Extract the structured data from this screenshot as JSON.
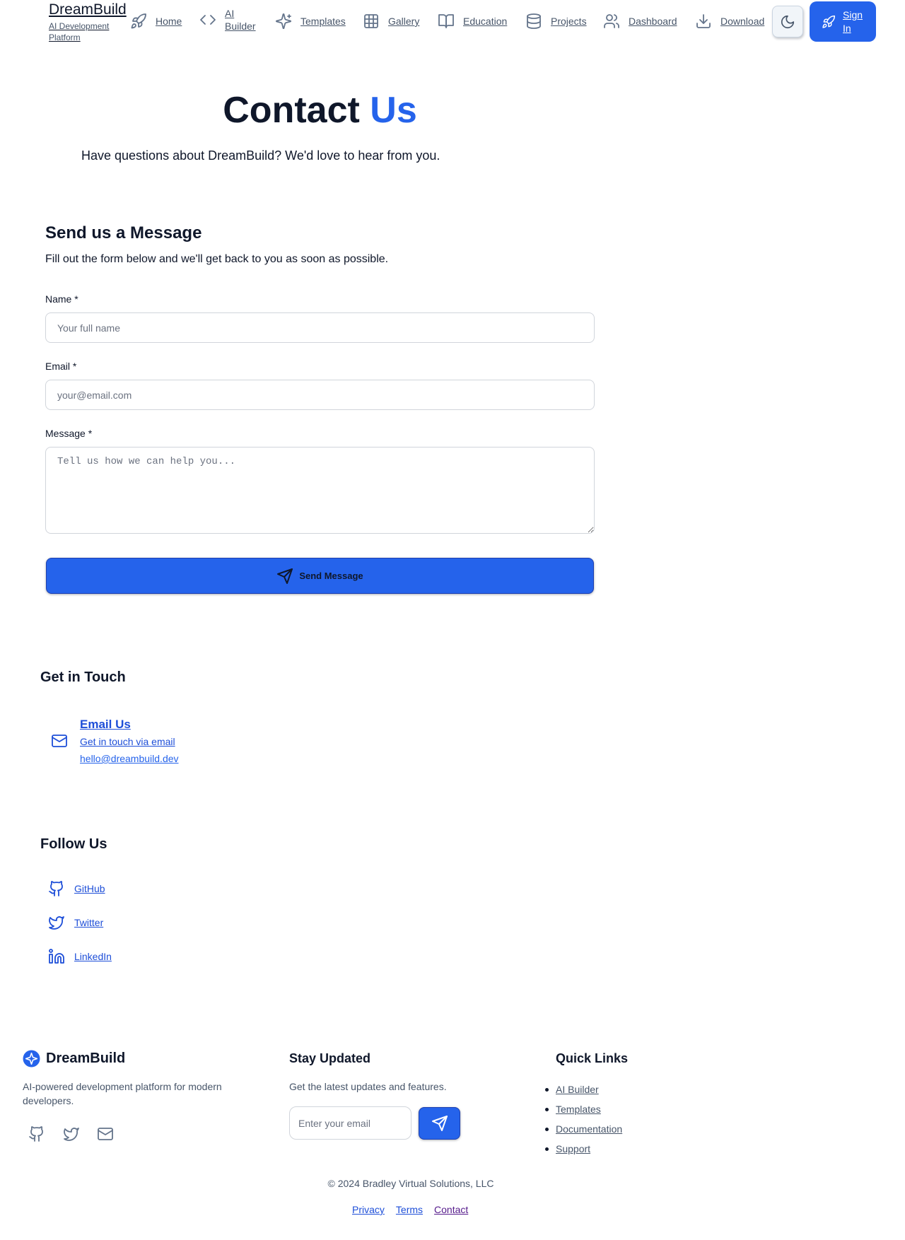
{
  "header": {
    "brand": "DreamBuild",
    "tagline": "AI Development Platform",
    "nav": [
      {
        "label": "Home",
        "icon": "rocket-icon"
      },
      {
        "label": "AI Builder",
        "icon": "code-icon"
      },
      {
        "label": "Templates",
        "icon": "sparkles-icon"
      },
      {
        "label": "Gallery",
        "icon": "grid-icon"
      },
      {
        "label": "Education",
        "icon": "book-open-icon"
      },
      {
        "label": "Projects",
        "icon": "database-icon"
      },
      {
        "label": "Dashboard",
        "icon": "users-icon"
      },
      {
        "label": "Download",
        "icon": "download-icon"
      }
    ],
    "theme_toggle_icon": "moon-icon",
    "signin": "Sign In"
  },
  "hero": {
    "title_main": "Contact",
    "title_accent": "Us",
    "subtitle": "Have questions about DreamBuild? We'd love to hear from you."
  },
  "form": {
    "title": "Send us a Message",
    "description": "Fill out the form below and we'll get back to you as soon as possible.",
    "name_label": "Name *",
    "name_placeholder": "Your full name",
    "email_label": "Email *",
    "email_placeholder": "your@email.com",
    "message_label": "Message *",
    "message_placeholder": "Tell us how we can help you...",
    "submit": "Send Message"
  },
  "contact": {
    "title": "Get in Touch",
    "email_title": "Email Us",
    "email_desc": "Get in touch via email",
    "email_address": "hello@dreambuild.dev"
  },
  "follow": {
    "title": "Follow Us",
    "items": [
      {
        "label": "GitHub",
        "icon": "github-icon"
      },
      {
        "label": "Twitter",
        "icon": "twitter-icon"
      },
      {
        "label": "LinkedIn",
        "icon": "linkedin-icon"
      }
    ]
  },
  "footer": {
    "brand": "DreamBuild",
    "description": "AI-powered development platform for modern developers.",
    "newsletter_title": "Stay Updated",
    "newsletter_desc": "Get the latest updates and features.",
    "newsletter_placeholder": "Enter your email",
    "links_title": "Quick Links",
    "links": [
      "AI Builder",
      "Templates",
      "Documentation",
      "Support"
    ],
    "copyright": "© 2024 Bradley Virtual Solutions, LLC",
    "legal": [
      "Privacy",
      "Terms",
      "Contact"
    ]
  },
  "colors": {
    "primary": "#2563eb",
    "text": "#0f172a",
    "muted": "#475569",
    "link": "#1d4ed8",
    "visited_link": "#551a8b"
  }
}
